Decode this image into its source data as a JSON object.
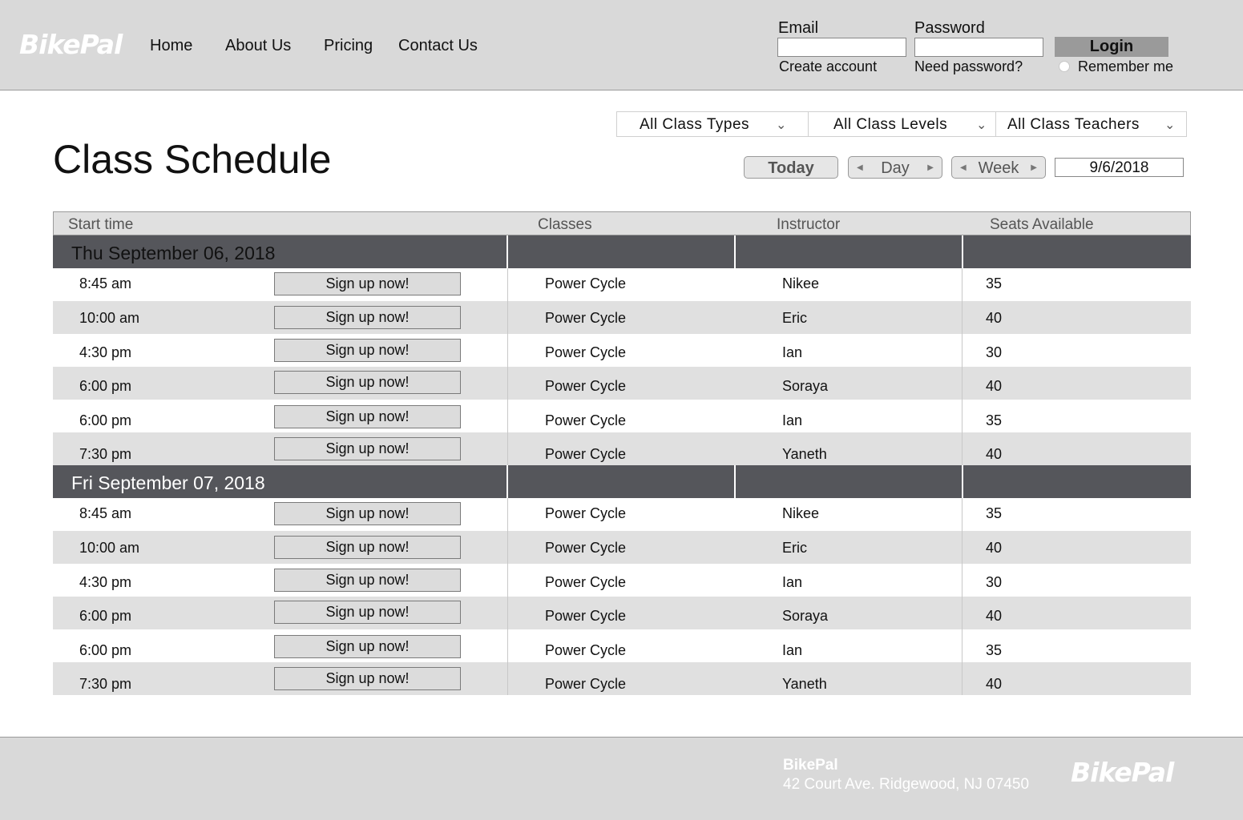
{
  "brand": {
    "logo": "BikePal"
  },
  "nav": {
    "items": [
      "Home",
      "About Us",
      "Pricing",
      "Contact Us"
    ]
  },
  "login": {
    "email_label": "Email",
    "email_value": "",
    "password_label": "Password",
    "password_value": "",
    "create_account": "Create account",
    "need_password": "Need password?",
    "login_button": "Login",
    "remember_me": "Remember me"
  },
  "filters": {
    "class_types": "All Class Types",
    "class_levels": "All Class Levels",
    "class_teachers": "All Class Teachers"
  },
  "page": {
    "title": "Class Schedule"
  },
  "controls": {
    "today": "Today",
    "day": "Day",
    "week": "Week",
    "date": "9/6/2018"
  },
  "table": {
    "headers": {
      "start_time": "Start time",
      "classes": "Classes",
      "instructor": "Instructor",
      "seats": "Seats Available"
    },
    "signup_label": "Sign up now!",
    "days": [
      {
        "label": "Thu September 06, 2018",
        "rows": [
          {
            "time": "8:45 am",
            "class": "Power Cycle",
            "instructor": "Nikee",
            "seats": "35"
          },
          {
            "time": "10:00 am",
            "class": "Power Cycle",
            "instructor": "Eric",
            "seats": "40"
          },
          {
            "time": "4:30 pm",
            "class": "Power Cycle",
            "instructor": "Ian",
            "seats": "30"
          },
          {
            "time": "6:00 pm",
            "class": "Power Cycle",
            "instructor": "Soraya",
            "seats": "40"
          },
          {
            "time": "6:00 pm",
            "class": "Power Cycle",
            "instructor": "Ian",
            "seats": "35"
          },
          {
            "time": "7:30 pm",
            "class": "Power Cycle",
            "instructor": "Yaneth",
            "seats": "40"
          }
        ]
      },
      {
        "label": "Fri September 07, 2018",
        "rows": [
          {
            "time": "8:45 am",
            "class": "Power Cycle",
            "instructor": "Nikee",
            "seats": "35"
          },
          {
            "time": "10:00 am",
            "class": "Power Cycle",
            "instructor": "Eric",
            "seats": "40"
          },
          {
            "time": "4:30 pm",
            "class": "Power Cycle",
            "instructor": "Ian",
            "seats": "30"
          },
          {
            "time": "6:00 pm",
            "class": "Power Cycle",
            "instructor": "Soraya",
            "seats": "40"
          },
          {
            "time": "6:00 pm",
            "class": "Power Cycle",
            "instructor": "Ian",
            "seats": "35"
          },
          {
            "time": "7:30 pm",
            "class": "Power Cycle",
            "instructor": "Yaneth",
            "seats": "40"
          }
        ]
      }
    ]
  },
  "footer": {
    "name": "BikePal",
    "address": "42 Court Ave. Ridgewood, NJ 07450",
    "logo": "BikePal"
  },
  "colors": {
    "header_bg": "#d9d9d9",
    "day_row_bg": "#55565b",
    "alt_row_bg": "#e0e0e0",
    "login_button_bg": "#9a9a9a"
  },
  "icons": {
    "dropdown": "chevron-down-icon",
    "prev": "triangle-left-icon",
    "next": "triangle-right-icon",
    "remember": "radio-icon"
  }
}
